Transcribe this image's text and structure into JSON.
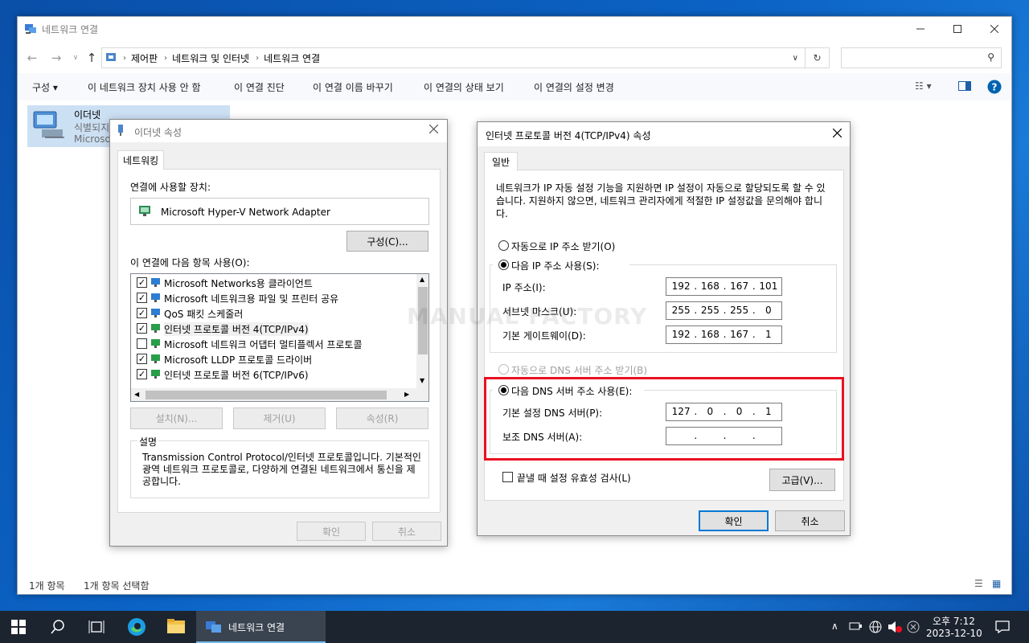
{
  "explorer": {
    "title": "네트워크 연결",
    "breadcrumb": [
      "제어판",
      "네트워크 및 인터넷",
      "네트워크 연결"
    ],
    "commands": [
      "구성",
      "이 네트워크 장치 사용 안 함",
      "이 연결 진단",
      "이 연결 이름 바꾸기",
      "이 연결의 상태 보기",
      "이 연결의 설정 변경"
    ],
    "item": {
      "name": "이더넷",
      "status": "식별되지",
      "device": "Microso"
    },
    "status_left": "1개 항목",
    "status_selected": "1개 항목 선택함",
    "watermark": "MANUAL FACTORY"
  },
  "eth_props": {
    "title": "이더넷 속성",
    "tab": "네트워킹",
    "connect_using_label": "연결에 사용할 장치:",
    "adapter": "Microsoft Hyper-V Network Adapter",
    "configure_btn": "구성(C)...",
    "items_label": "이 연결에 다음 항목 사용(O):",
    "items": [
      {
        "label": "Microsoft Networks용 클라이언트",
        "checked": true
      },
      {
        "label": "Microsoft 네트워크용 파일 및 프린터 공유",
        "checked": true
      },
      {
        "label": "QoS 패킷 스케줄러",
        "checked": true
      },
      {
        "label": "인터넷 프로토콜 버전 4(TCP/IPv4)",
        "checked": true
      },
      {
        "label": "Microsoft 네트워크 어댑터 멀티플렉서 프로토콜",
        "checked": false
      },
      {
        "label": "Microsoft LLDP 프로토콜 드라이버",
        "checked": true
      },
      {
        "label": "인터넷 프로토콜 버전 6(TCP/IPv6)",
        "checked": true
      }
    ],
    "install_btn": "설치(N)...",
    "remove_btn": "제거(U)",
    "properties_btn": "속성(R)",
    "desc_title": "설명",
    "desc_text": "Transmission Control Protocol/인터넷 프로토콜입니다. 기본적인 광역 네트워크 프로토콜로, 다양하게 연결된 네트워크에서 통신을 제공합니다.",
    "ok": "확인",
    "cancel": "취소"
  },
  "ipv4": {
    "title": "인터넷 프로토콜 버전 4(TCP/IPv4) 속성",
    "tab": "일반",
    "intro": "네트워크가 IP 자동 설정 기능을 지원하면 IP 설정이 자동으로 할당되도록 할 수 있습니다. 지원하지 않으면, 네트워크 관리자에게 적절한 IP 설정값을 문의해야 합니다.",
    "auto_ip": "자동으로 IP 주소 받기(O)",
    "manual_ip": "다음 IP 주소 사용(S):",
    "ip_label": "IP 주소(I):",
    "ip": [
      "192",
      "168",
      "167",
      "101"
    ],
    "mask_label": "서브넷 마스크(U):",
    "mask": [
      "255",
      "255",
      "255",
      "0"
    ],
    "gw_label": "기본 게이트웨이(D):",
    "gw": [
      "192",
      "168",
      "167",
      "1"
    ],
    "auto_dns": "자동으로 DNS 서버 주소 받기(B)",
    "manual_dns": "다음 DNS 서버 주소 사용(E):",
    "dns1_label": "기본 설정 DNS 서버(P):",
    "dns1": [
      "127",
      "0",
      "0",
      "1"
    ],
    "dns2_label": "보조 DNS 서버(A):",
    "validate": "끝낼 때 설정 유효성 검사(L)",
    "advanced": "고급(V)...",
    "ok": "확인",
    "cancel": "취소",
    "highlight_color": "#e81123"
  },
  "taskbar": {
    "active_app": "네트워크 연결",
    "time": "오후 7:12",
    "date": "2023-12-10"
  }
}
